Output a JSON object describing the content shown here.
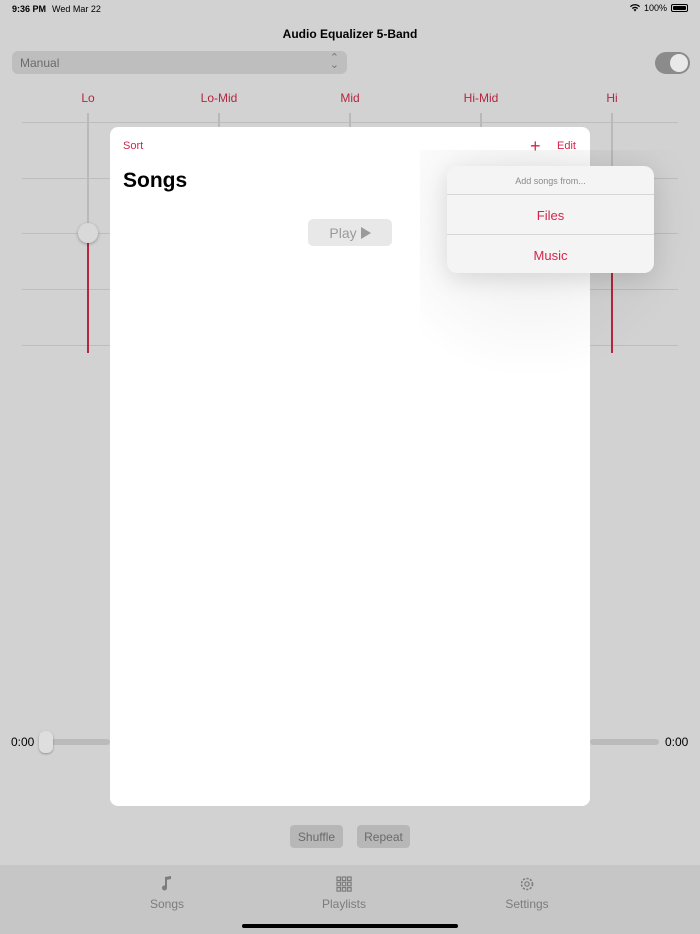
{
  "status": {
    "time": "9:36 PM",
    "date": "Wed Mar 22",
    "battery": "100%"
  },
  "app": {
    "title": "Audio Equalizer 5-Band"
  },
  "preset": {
    "value": "Manual"
  },
  "bands": [
    "Lo",
    "Lo-Mid",
    "Mid",
    "Hi-Mid",
    "Hi"
  ],
  "player": {
    "elapsed": "0:00",
    "remaining": "0:00",
    "shuffle": "Shuffle",
    "repeat": "Repeat"
  },
  "tabs": [
    "Songs",
    "Playlists",
    "Settings"
  ],
  "modal": {
    "sort": "Sort",
    "edit": "Edit",
    "title": "Songs",
    "play": "Play"
  },
  "popover": {
    "header": "Add songs from...",
    "items": [
      "Files",
      "Music"
    ]
  },
  "colors": {
    "accent": "#d5244b",
    "band_label": "#b5263f"
  }
}
